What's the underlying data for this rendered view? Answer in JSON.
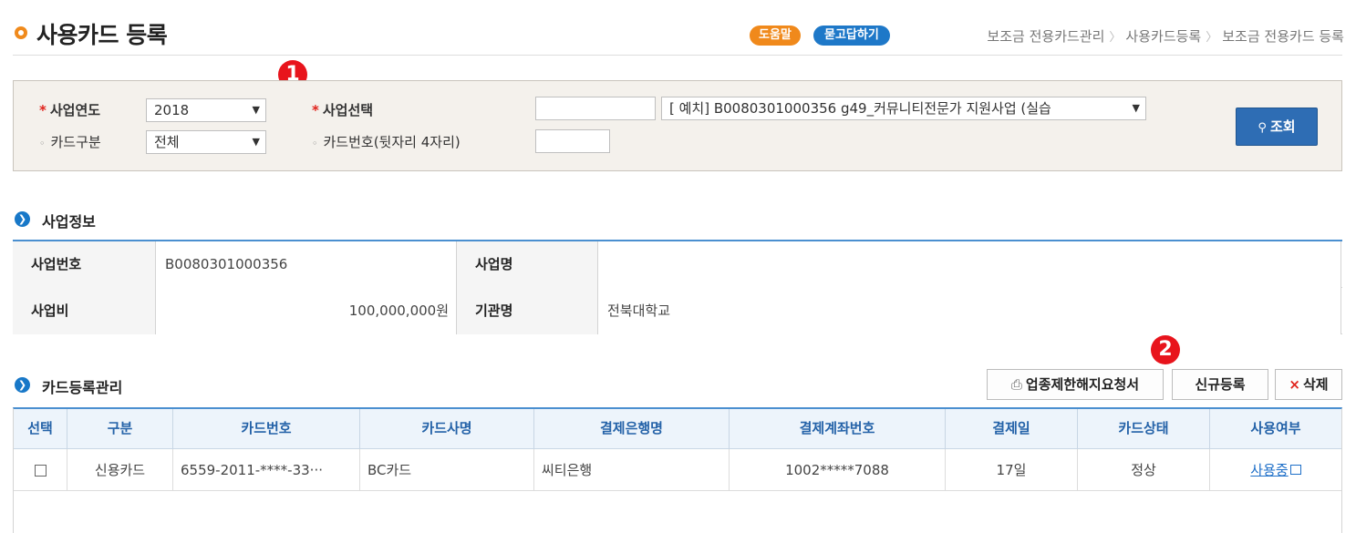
{
  "header": {
    "title": "사용카드 등록",
    "help_label": "도움말",
    "qa_label": "묻고답하기",
    "breadcrumb": [
      "보조금 전용카드관리",
      "사용카드등록",
      "보조금 전용카드 등록"
    ]
  },
  "badges": [
    "1",
    "2"
  ],
  "search": {
    "year_label": "사업연도",
    "year_value": "2018",
    "project_label": "사업선택",
    "project_code_value": "",
    "project_select_value": "[   예치] B0080301000356 g49_커뮤니티전문가 지원사업 (실습",
    "card_type_label": "카드구분",
    "card_type_value": "전체",
    "card_num_label": "카드번호(뒷자리 4자리)",
    "card_num_value": "",
    "search_button": "조회"
  },
  "project_info": {
    "section_title": "사업정보",
    "project_no_label": "사업번호",
    "project_no_value": "B0080301000356",
    "project_name_label": "사업명",
    "project_name_value": "",
    "budget_label": "사업비",
    "budget_value": "100,000,000원",
    "org_label": "기관명",
    "org_value": "전북대학교"
  },
  "card_mgmt": {
    "section_title": "카드등록관리",
    "btn_request": "업종제한해지요청서",
    "btn_new": "신규등록",
    "btn_delete": "삭제",
    "columns": [
      "선택",
      "구분",
      "카드번호",
      "카드사명",
      "결제은행명",
      "결제계좌번호",
      "결제일",
      "카드상태",
      "사용여부"
    ],
    "rows": [
      {
        "type": "신용카드",
        "card_no": "6559-2011-****-33···",
        "card_company": "BC카드",
        "bank": "씨티은행",
        "account": "1002*****7088",
        "pay_day": "17일",
        "status": "정상",
        "usage": "사용중"
      }
    ]
  },
  "colors": {
    "accent_orange": "#f0891b",
    "accent_blue": "#1e78c8",
    "badge_red": "#e8141c",
    "table_border": "#4a8fd0"
  },
  "icons": [
    "title-bullet-icon",
    "search-icon",
    "chevron-right-icon",
    "print-icon",
    "close-icon",
    "external-link-icon",
    "dropdown-arrow-icon"
  ]
}
